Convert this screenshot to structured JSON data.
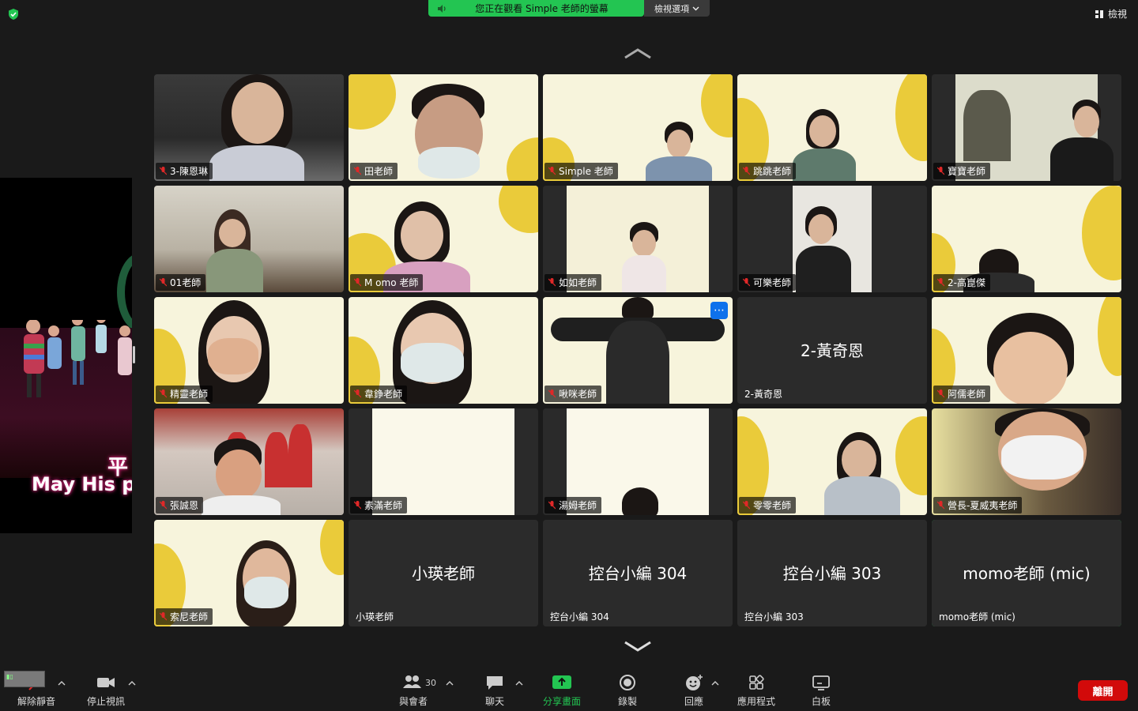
{
  "top": {
    "share_banner": "您正在觀看 Simple 老師的螢幕",
    "view_options": "檢視選項",
    "view": "檢視"
  },
  "share": {
    "lyric_line1": "平",
    "lyric_line2": "May His pe"
  },
  "tiles": [
    {
      "name": "3-陳恩琳",
      "muted": true
    },
    {
      "name": "田老師",
      "muted": true
    },
    {
      "name": "Simple 老師",
      "muted": true
    },
    {
      "name": "跳跳老師",
      "muted": true
    },
    {
      "name": "寶寶老師",
      "muted": true
    },
    {
      "name": "01老師",
      "muted": true
    },
    {
      "name": "M omo 老師",
      "muted": true
    },
    {
      "name": "如如老師",
      "muted": true
    },
    {
      "name": "可樂老師",
      "muted": true
    },
    {
      "name": "2-高崑傑",
      "muted": true
    },
    {
      "name": "精靈老師",
      "muted": true
    },
    {
      "name": "韋錚老師",
      "muted": true
    },
    {
      "name": "啾咪老師",
      "muted": true
    },
    {
      "name": "2-黃奇恩",
      "muted": false,
      "video_off": true
    },
    {
      "name": "阿儒老師",
      "muted": true
    },
    {
      "name": "張誠恩",
      "muted": true
    },
    {
      "name": "素滿老師",
      "muted": true
    },
    {
      "name": "湯姆老師",
      "muted": true
    },
    {
      "name": "零零老師",
      "muted": true
    },
    {
      "name": "營長-夏威夷老師",
      "muted": true
    },
    {
      "name": "索尼老師",
      "muted": true
    },
    {
      "name": "小瑛老師",
      "muted": false,
      "video_off": true
    },
    {
      "name": "控台小編 304",
      "muted": false,
      "video_off": true
    },
    {
      "name": "控台小編 303",
      "muted": false,
      "video_off": true
    },
    {
      "name": "momo老師 (mic)",
      "muted": false,
      "video_off": true,
      "active": true
    }
  ],
  "toolbar": {
    "unmute": "解除靜音",
    "stop_video": "停止視訊",
    "participants": "與會者",
    "participants_count": "30",
    "chat": "聊天",
    "share_screen": "分享畫面",
    "record": "錄製",
    "reactions": "回應",
    "apps": "應用程式",
    "whiteboard": "白板",
    "leave": "離開"
  },
  "colors": {
    "accent_green": "#23c552",
    "leave_red": "#d20a0a",
    "more_blue": "#0e71eb"
  }
}
